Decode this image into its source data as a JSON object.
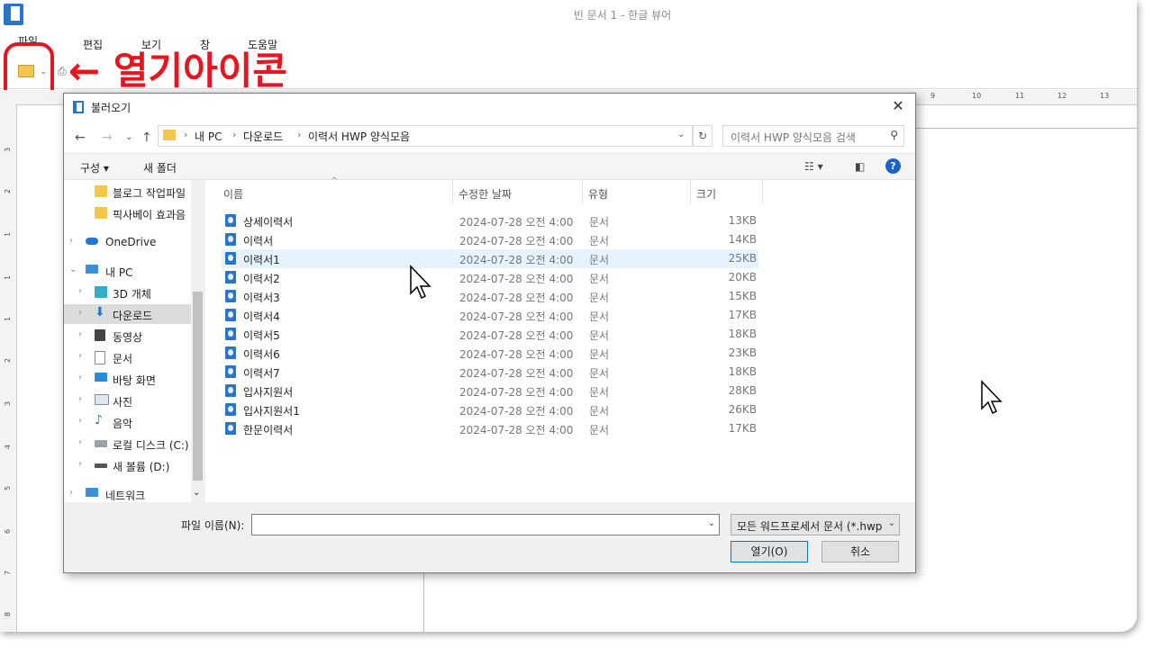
{
  "app": {
    "title": "빈 문서 1 - 한글 뷰어",
    "menu": [
      "파일",
      "편집",
      "보기",
      "창",
      "도움말"
    ],
    "annotation": "← 열기아이콘",
    "ruler_top": [
      "9",
      "10",
      "11",
      "12",
      "13"
    ],
    "ruler_left": [
      "3",
      "2",
      "1",
      "1",
      "1",
      "2",
      "3",
      "4",
      "5",
      "6",
      "7",
      "8"
    ]
  },
  "dialog": {
    "title": "불러오기",
    "close_glyph": "✕",
    "breadcrumb": [
      "내 PC",
      "다운로드",
      "이력서 HWP 양식모음"
    ],
    "search_placeholder": "이력서 HWP 양식모음 검색",
    "organize_label": "구성 ▾",
    "new_folder_label": "새 폴더",
    "help_glyph": "?",
    "nav_items": [
      {
        "label": "블로그 작업파일",
        "icon": "folder-icon"
      },
      {
        "label": "픽사베이 효과음",
        "icon": "folder-icon"
      },
      {
        "label": "OneDrive",
        "icon": "cloud-icon"
      },
      {
        "label": "내 PC",
        "icon": "pc-icon"
      },
      {
        "label": "3D 개체",
        "icon": "cube-icon"
      },
      {
        "label": "다운로드",
        "icon": "download-icon"
      },
      {
        "label": "동영상",
        "icon": "video-icon"
      },
      {
        "label": "문서",
        "icon": "document-icon"
      },
      {
        "label": "바탕 화면",
        "icon": "desktop-icon"
      },
      {
        "label": "사진",
        "icon": "pictures-icon"
      },
      {
        "label": "음악",
        "icon": "music-icon"
      },
      {
        "label": "로컬 디스크 (C:)",
        "icon": "drive-icon"
      },
      {
        "label": "새 볼륨 (D:)",
        "icon": "drive-icon"
      },
      {
        "label": "네트워크",
        "icon": "network-icon"
      }
    ],
    "columns": [
      "이름",
      "수정한 날짜",
      "유형",
      "크기"
    ],
    "files": [
      {
        "name": "상세이력서",
        "date": "2024-07-28 오전 4:00",
        "type": "문서",
        "size": "13KB"
      },
      {
        "name": "이력서",
        "date": "2024-07-28 오전 4:00",
        "type": "문서",
        "size": "14KB"
      },
      {
        "name": "이력서1",
        "date": "2024-07-28 오전 4:00",
        "type": "문서",
        "size": "25KB"
      },
      {
        "name": "이력서2",
        "date": "2024-07-28 오전 4:00",
        "type": "문서",
        "size": "20KB"
      },
      {
        "name": "이력서3",
        "date": "2024-07-28 오전 4:00",
        "type": "문서",
        "size": "15KB"
      },
      {
        "name": "이력서4",
        "date": "2024-07-28 오전 4:00",
        "type": "문서",
        "size": "17KB"
      },
      {
        "name": "이력서5",
        "date": "2024-07-28 오전 4:00",
        "type": "문서",
        "size": "18KB"
      },
      {
        "name": "이력서6",
        "date": "2024-07-28 오전 4:00",
        "type": "문서",
        "size": "23KB"
      },
      {
        "name": "이력서7",
        "date": "2024-07-28 오전 4:00",
        "type": "문서",
        "size": "18KB"
      },
      {
        "name": "입사지원서",
        "date": "2024-07-28 오전 4:00",
        "type": "문서",
        "size": "28KB"
      },
      {
        "name": "입사지원서1",
        "date": "2024-07-28 오전 4:00",
        "type": "문서",
        "size": "26KB"
      },
      {
        "name": "한문이력서",
        "date": "2024-07-28 오전 4:00",
        "type": "문서",
        "size": "17KB"
      }
    ],
    "filename_label": "파일 이름(N):",
    "filename_value": "",
    "filetype_value": "모든 워드프로세서 문서 (*.hwp",
    "open_label": "열기(O)",
    "cancel_label": "취소"
  },
  "colors": {
    "annotation": "#e8141e",
    "accent": "#0078d7"
  }
}
